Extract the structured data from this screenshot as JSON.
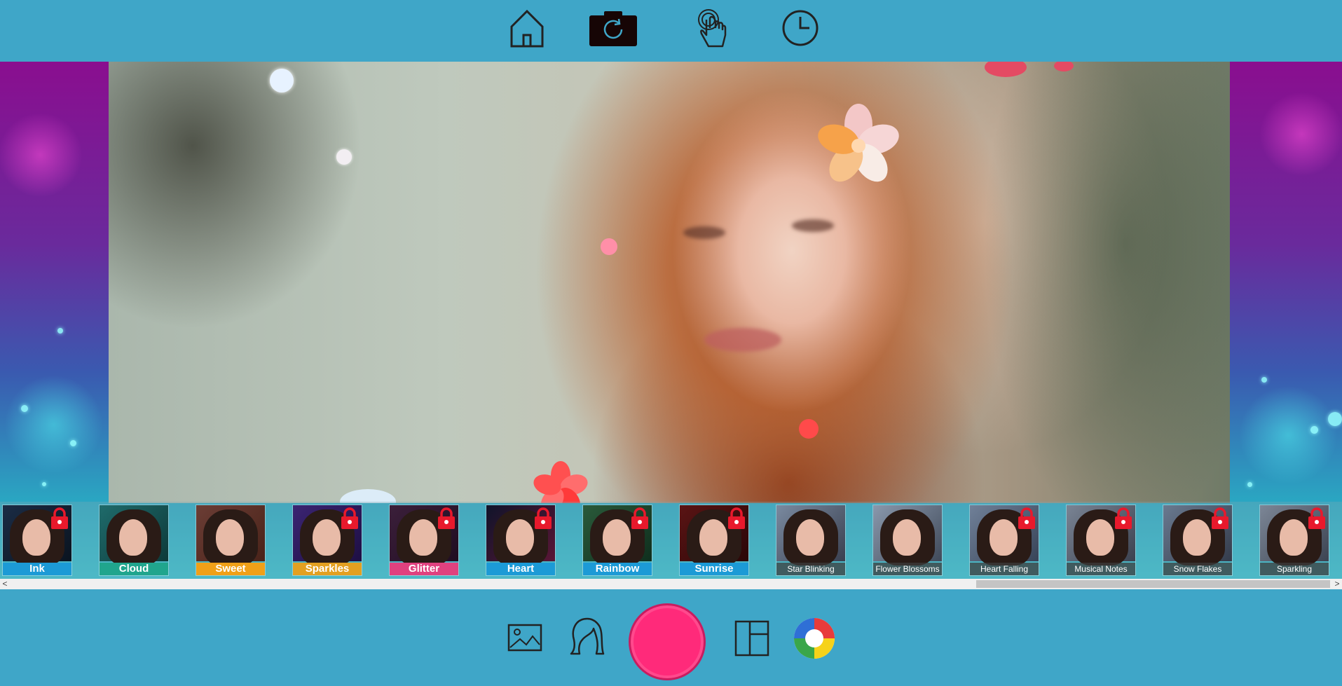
{
  "top_nav": {
    "items": [
      {
        "name": "home",
        "icon": "home-icon"
      },
      {
        "name": "camera-switch",
        "icon": "camera-rotate-icon"
      },
      {
        "name": "touch",
        "icon": "touch-hand-icon"
      },
      {
        "name": "history",
        "icon": "clock-icon"
      }
    ]
  },
  "filters": {
    "items": [
      {
        "label": "Ink",
        "locked": true,
        "color": "#1c9ad6"
      },
      {
        "label": "Cloud",
        "locked": false,
        "color": "#20a58d"
      },
      {
        "label": "Sweet",
        "locked": false,
        "color": "#f0a018"
      },
      {
        "label": "Sparkles",
        "locked": true,
        "color": "#e3a021"
      },
      {
        "label": "Glitter",
        "locked": true,
        "color": "#e0417f"
      },
      {
        "label": "Heart",
        "locked": true,
        "color": "#1c9ad6"
      },
      {
        "label": "Rainbow",
        "locked": true,
        "color": "#1c9ad6"
      },
      {
        "label": "Sunrise",
        "locked": true,
        "color": "#1c9ad6"
      },
      {
        "label": "Star Blinking",
        "locked": false,
        "color": "#4a4a4a"
      },
      {
        "label": "Flower Blossoms",
        "locked": false,
        "color": "#4a4a4a"
      },
      {
        "label": "Heart Falling",
        "locked": true,
        "color": "#4a4a4a"
      },
      {
        "label": "Musical Notes",
        "locked": true,
        "color": "#4a4a4a"
      },
      {
        "label": "Snow Flakes",
        "locked": true,
        "color": "#4a4a4a"
      },
      {
        "label": "Sparkling",
        "locked": true,
        "color": "#4a4a4a"
      }
    ]
  },
  "bottom_nav": {
    "items": [
      {
        "name": "gallery",
        "icon": "image-icon"
      },
      {
        "name": "hair-style",
        "icon": "hair-icon"
      },
      {
        "name": "capture",
        "icon": "shutter-button"
      },
      {
        "name": "layout",
        "icon": "layout-icon"
      },
      {
        "name": "effects",
        "icon": "color-wheel-icon"
      }
    ]
  },
  "colors": {
    "accent": "#3fa6c8",
    "capture": "#ff2a7a",
    "lock": "#e8192c"
  }
}
